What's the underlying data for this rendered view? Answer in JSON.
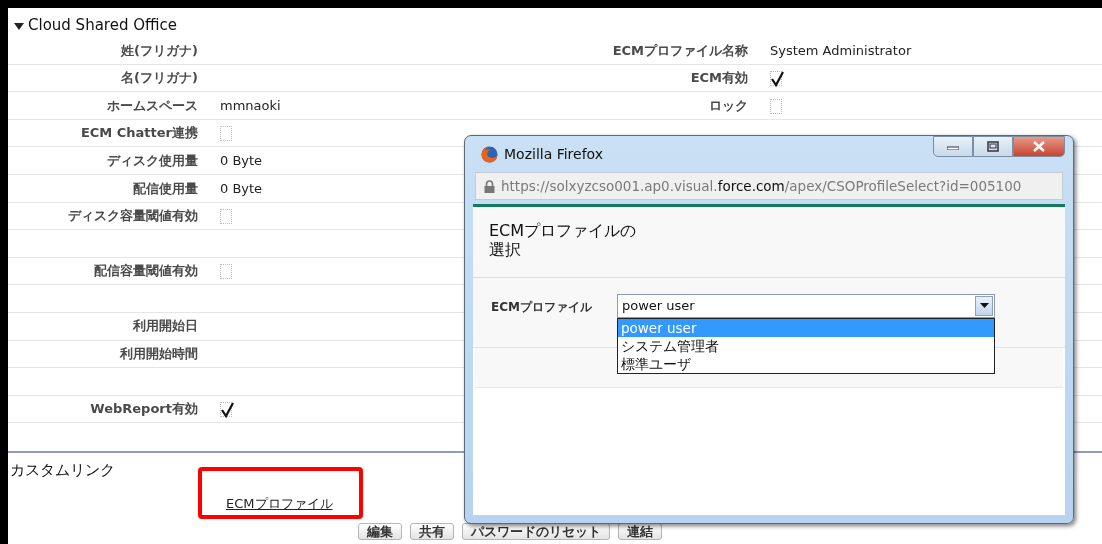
{
  "section": {
    "title": "Cloud Shared Office",
    "expanded": true
  },
  "rows": [
    {
      "kind": "field",
      "left": {
        "label": "姓(フリガナ)"
      },
      "right": {
        "label": "ECMプロファイル名称",
        "kind": "text",
        "value": "System Administrator"
      }
    },
    {
      "kind": "field",
      "left": {
        "label": "名(フリガナ)"
      },
      "right": {
        "label": "ECM有効",
        "kind": "checkbox",
        "checked": true
      }
    },
    {
      "kind": "field",
      "left": {
        "label": "ホームスペース",
        "kind": "text",
        "value": "mmnaoki"
      },
      "right": {
        "label": "ロック",
        "kind": "checkbox",
        "checked": false
      }
    },
    {
      "kind": "field",
      "left": {
        "label": "ECM Chatter連携",
        "kind": "checkbox",
        "checked": false
      }
    },
    {
      "kind": "field",
      "left": {
        "label": "ディスク使用量",
        "kind": "text",
        "value": "0 Byte"
      }
    },
    {
      "kind": "field",
      "left": {
        "label": "配信使用量",
        "kind": "text",
        "value": "0 Byte"
      }
    },
    {
      "kind": "field",
      "left": {
        "label": "ディスク容量閾値有効",
        "kind": "checkbox",
        "checked": false
      }
    },
    {
      "kind": "blank"
    },
    {
      "kind": "field",
      "left": {
        "label": "配信容量閾値有効",
        "kind": "checkbox",
        "checked": false
      }
    },
    {
      "kind": "blank"
    },
    {
      "kind": "field",
      "left": {
        "label": "利用開始日"
      }
    },
    {
      "kind": "field",
      "left": {
        "label": "利用開始時間"
      }
    },
    {
      "kind": "blank"
    },
    {
      "kind": "field",
      "left": {
        "label": "WebReport有効",
        "kind": "checkbox",
        "checked": true
      }
    }
  ],
  "custom_links": {
    "title": "カスタムリンク",
    "links": [
      {
        "label": "ECMプロファイル",
        "highlighted": true
      }
    ]
  },
  "buttons": [
    {
      "label": "編集"
    },
    {
      "label": "共有"
    },
    {
      "label": "パスワードのリセット"
    },
    {
      "label": "連結"
    }
  ],
  "popup": {
    "title": "Mozilla Firefox",
    "url": {
      "prefix": "https://solxyzcso001.ap0.visual.",
      "domain": "force.com",
      "path": "/apex/CSOProfileSelect?id=005100"
    },
    "heading": "ECMプロファイルの選択",
    "field": {
      "label": "ECMプロファイル",
      "value": "power user",
      "expanded": true,
      "options": [
        {
          "label": "power user",
          "selected": true
        },
        {
          "label": "システム管理者",
          "selected": false
        },
        {
          "label": "標準ユーザ",
          "selected": false
        }
      ]
    }
  }
}
